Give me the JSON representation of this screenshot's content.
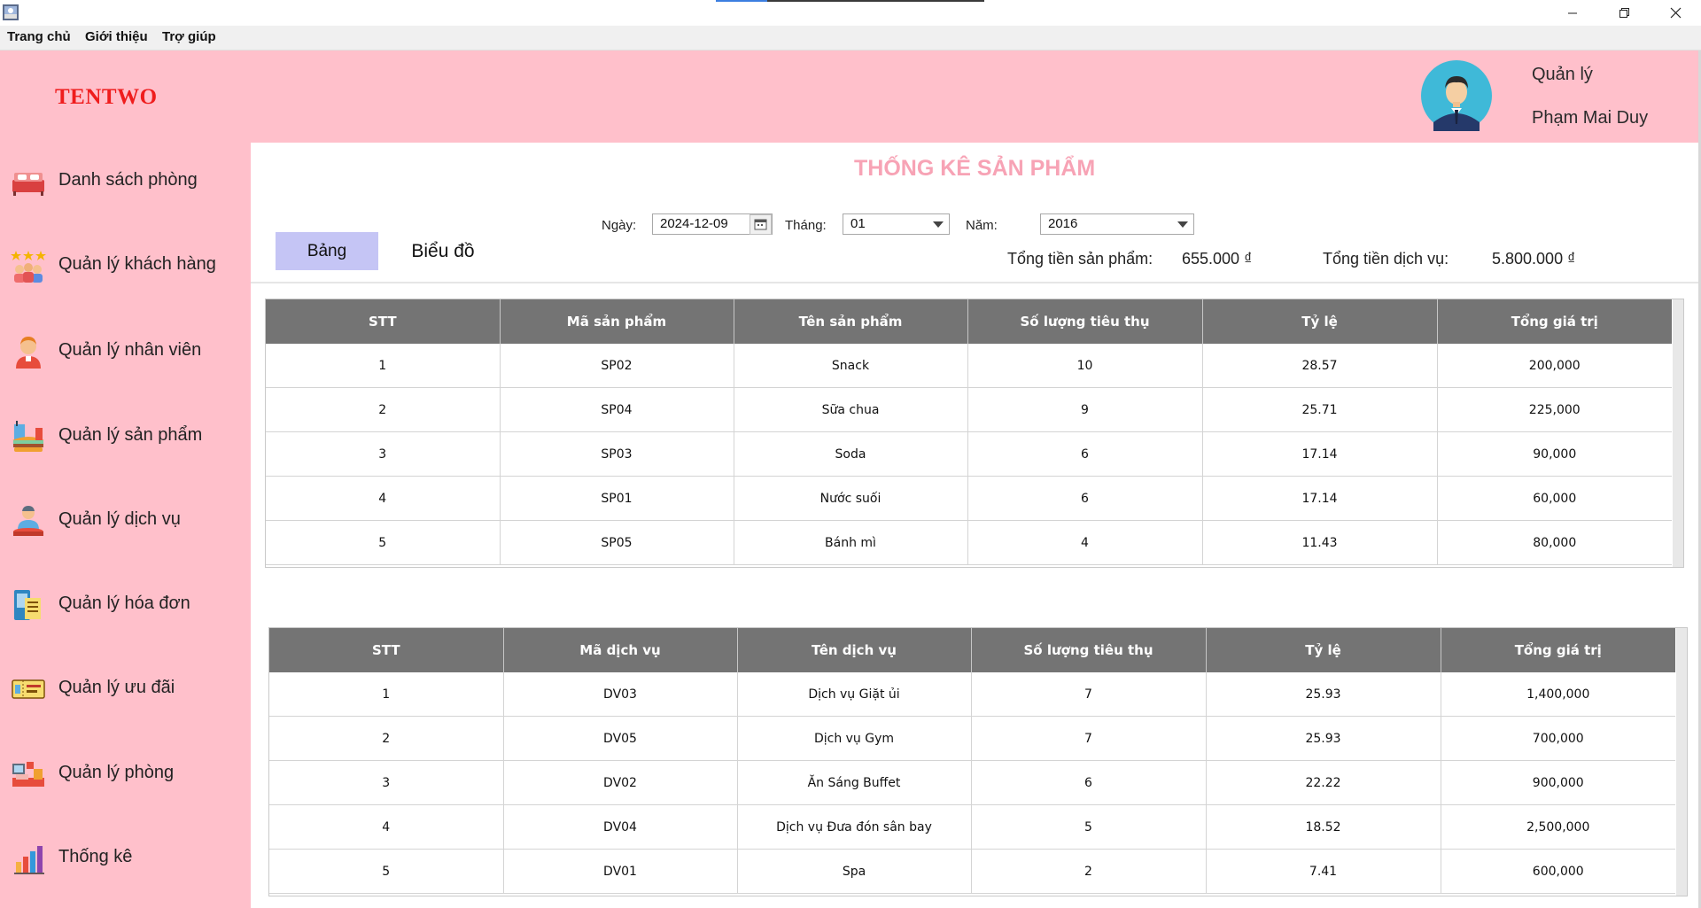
{
  "menu": {
    "items": [
      "Trang chủ",
      "Giới thiệu",
      "Trợ giúp"
    ]
  },
  "header": {
    "brand": "TENTWO",
    "role": "Quản lý",
    "user_name": "Phạm Mai Duy"
  },
  "sidebar": {
    "items": [
      {
        "label": "Danh sách phòng",
        "icon": "room-list-icon"
      },
      {
        "label": "Quản lý khách hàng",
        "icon": "customers-icon"
      },
      {
        "label": "Quản lý nhân viên",
        "icon": "staff-icon"
      },
      {
        "label": "Quản lý sản phẩm",
        "icon": "products-icon"
      },
      {
        "label": "Quản lý dịch vụ",
        "icon": "services-icon"
      },
      {
        "label": "Quản lý hóa đơn",
        "icon": "invoices-icon"
      },
      {
        "label": "Quản lý ưu đãi",
        "icon": "promotions-icon"
      },
      {
        "label": "Quản lý phòng",
        "icon": "rooms-icon"
      },
      {
        "label": "Thống kê",
        "icon": "statistics-icon"
      }
    ]
  },
  "main": {
    "title": "THỐNG KÊ SẢN PHẨM",
    "filters": {
      "date_label": "Ngày:",
      "date_value": "2024-12-09",
      "month_label": "Tháng:",
      "month_value": "01",
      "year_label": "Năm:",
      "year_value": "2016"
    },
    "tabs": [
      "Bảng",
      "Biểu đồ"
    ],
    "totals": {
      "products_label": "Tổng tiền sản phẩm:",
      "products_value": "655.000 ₫",
      "services_label": "Tổng tiền dịch vụ:",
      "services_value": "5.800.000 ₫"
    },
    "product_table": {
      "headers": [
        "STT",
        "Mã sản phẩm",
        "Tên sản phẩm",
        "Số lượng tiêu thụ",
        "Tỷ lệ",
        "Tổng giá trị"
      ],
      "rows": [
        [
          "1",
          "SP02",
          "Snack",
          "10",
          "28.57",
          "200,000"
        ],
        [
          "2",
          "SP04",
          "Sữa chua",
          "9",
          "25.71",
          "225,000"
        ],
        [
          "3",
          "SP03",
          "Soda",
          "6",
          "17.14",
          "90,000"
        ],
        [
          "4",
          "SP01",
          "Nước suối",
          "6",
          "17.14",
          "60,000"
        ],
        [
          "5",
          "SP05",
          "Bánh mì",
          "4",
          "11.43",
          "80,000"
        ]
      ]
    },
    "service_table": {
      "headers": [
        "STT",
        "Mã dịch vụ",
        "Tên dịch vụ",
        "Số lượng tiêu thụ",
        "Tỷ lệ",
        "Tổng giá trị"
      ],
      "rows": [
        [
          "1",
          "DV03",
          "Dịch vụ Giặt ủi",
          "7",
          "25.93",
          "1,400,000"
        ],
        [
          "2",
          "DV05",
          "Dịch vụ Gym",
          "7",
          "25.93",
          "700,000"
        ],
        [
          "3",
          "DV02",
          "Ăn Sáng Buffet",
          "6",
          "22.22",
          "900,000"
        ],
        [
          "4",
          "DV04",
          "Dịch vụ Đưa đón sân bay",
          "5",
          "18.52",
          "2,500,000"
        ],
        [
          "5",
          "DV01",
          "Spa",
          "2",
          "7.41",
          "600,000"
        ]
      ]
    }
  }
}
